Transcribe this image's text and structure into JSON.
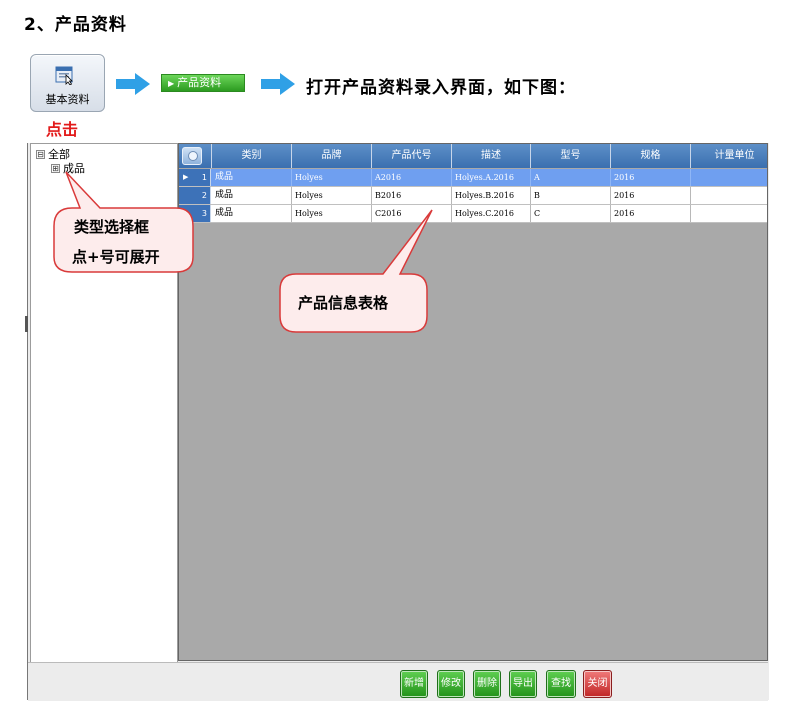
{
  "document": {
    "section_title": "2、产品资料",
    "base_button_label": "基本资料",
    "click_label": "点击",
    "menu_chip_label": "产品资料",
    "open_instruction": "打开产品资料录入界面，如下图："
  },
  "tree": {
    "root_label": "全部",
    "root_toggle": "⊟",
    "child_label": "成品",
    "child_toggle": "⊞"
  },
  "grid": {
    "columns": [
      "类别",
      "品牌",
      "产品代号",
      "描述",
      "型号",
      "规格",
      "计量单位"
    ],
    "rows": [
      {
        "num": "1",
        "category": "成品",
        "brand": "Holyes",
        "code": "A2016",
        "desc": "Holyes.A.2016",
        "model": "A",
        "spec": "2016",
        "unit": ""
      },
      {
        "num": "2",
        "category": "成品",
        "brand": "Holyes",
        "code": "B2016",
        "desc": "Holyes.B.2016",
        "model": "B",
        "spec": "2016",
        "unit": ""
      },
      {
        "num": "3",
        "category": "成品",
        "brand": "Holyes",
        "code": "C2016",
        "desc": "Holyes.C.2016",
        "model": "C",
        "spec": "2016",
        "unit": ""
      }
    ],
    "selected_row_pointer": "▶"
  },
  "buttons": {
    "add": "新增",
    "edit": "修改",
    "delete": "删除",
    "export": "导出",
    "find": "查找",
    "close": "关闭"
  },
  "callouts": {
    "tree_line1": "类型选择框",
    "tree_line2": "点+号可展开",
    "grid": "产品信息表格"
  },
  "colors": {
    "accent_blue": "#3a6fb0",
    "selected_row": "#6f9ff0",
    "button_green": "#23921a",
    "button_red": "#c02525",
    "click_red": "#e21a1a",
    "arrow_blue": "#2fa0e6"
  }
}
